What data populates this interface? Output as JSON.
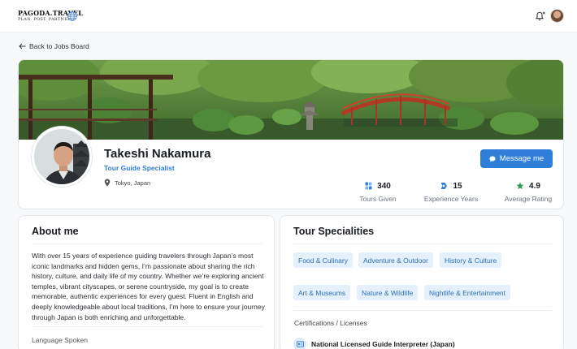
{
  "header": {
    "logo_title": "PAGODA.TRAVEL",
    "logo_subtitle": "PLAN. POST. PARTNER",
    "icons": [
      "globe-icon",
      "bell-icon",
      "user-avatar"
    ]
  },
  "nav": {
    "back_label": "Back to Jobs Board"
  },
  "profile": {
    "name": "Takeshi Nakamura",
    "role": "Tour Guide Specialist",
    "location": "Tokyo, Japan",
    "message_button": "Message me",
    "stats": [
      {
        "value": "340",
        "label": "Tours Given",
        "icon": "tours-icon"
      },
      {
        "value": "15",
        "label": "Experience Years",
        "icon": "badge-icon"
      },
      {
        "value": "4.9",
        "label": "Average Rating",
        "icon": "star-icon"
      }
    ]
  },
  "about": {
    "title": "About me",
    "text": "With over 15 years of experience guiding travelers through Japan’s most iconic landmarks and hidden gems, I’m passionate about sharing the rich history, culture, and daily life of my country. Whether we’re exploring ancient temples, vibrant cityscapes, or serene countryside, my goal is to create memorable, authentic experiences for every guest. Fluent in English and deeply knowledgeable about local traditions, I’m here to ensure your journey through Japan is both enriching and unforgettable.",
    "languages_label": "Language Spoken"
  },
  "specialities": {
    "title": "Tour Specialities",
    "tags": [
      "Food & Culinary",
      "Adventure & Outdoor",
      "History & Culture",
      "Art & Museums",
      "Nature & Wildlife",
      "Nightlife & Entertainment"
    ],
    "certifications_label": "Certifications / Licenses",
    "certification": "National Licensed Guide Interpreter (Japan)"
  },
  "colors": {
    "accent": "#2f7fd8",
    "tag_bg": "#e4f0fc",
    "tag_text": "#2f6fb5"
  }
}
